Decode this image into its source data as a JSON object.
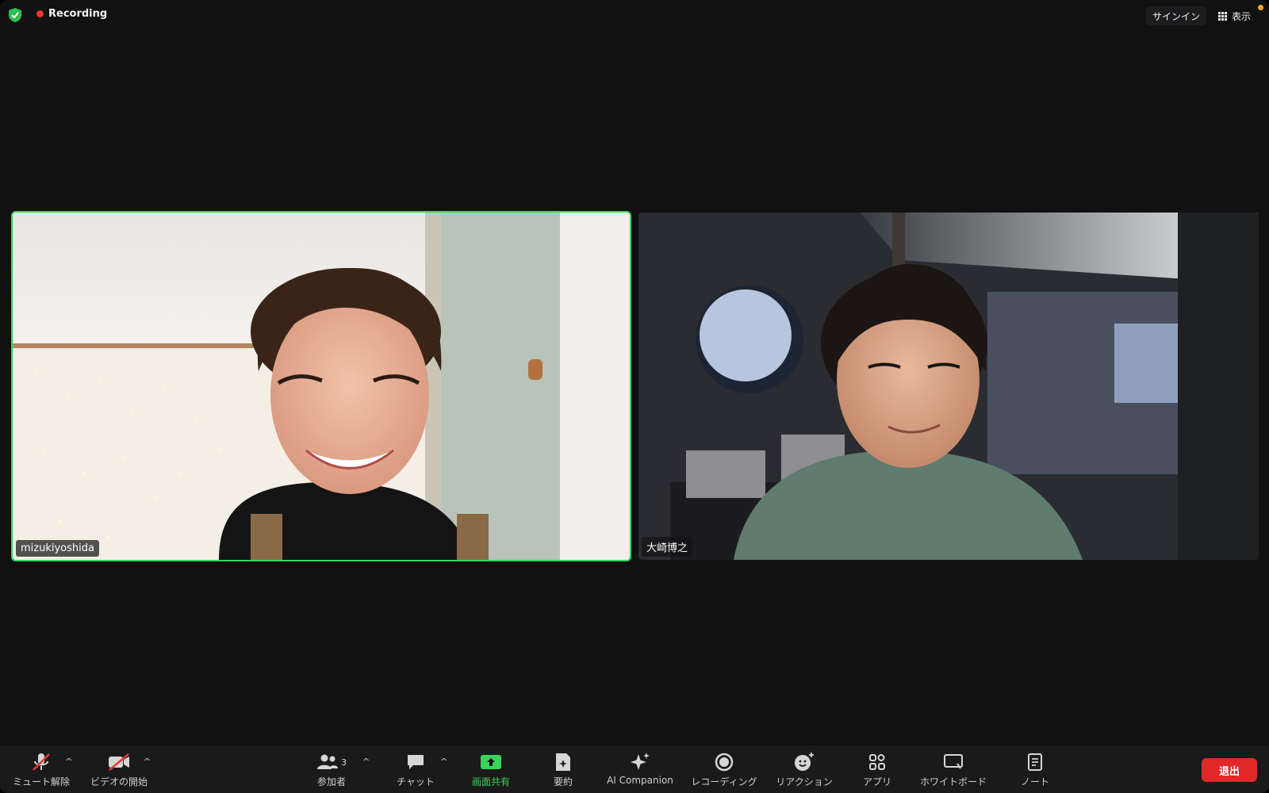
{
  "topbar": {
    "recording_label": "Recording",
    "signin_label": "サインイン",
    "view_label": "表示"
  },
  "participants": [
    {
      "name": "mizukiyoshida",
      "active_speaker": true
    },
    {
      "name": "大崎博之",
      "active_speaker": false
    }
  ],
  "toolbar": {
    "mute": "ミュート解除",
    "video": "ビデオの開始",
    "participants": "参加者",
    "participants_count": "3",
    "chat": "チャット",
    "share": "画面共有",
    "summary": "要約",
    "ai": "AI Companion",
    "record": "レコーディング",
    "reactions": "リアクション",
    "apps": "アプリ",
    "whiteboard": "ホワイトボード",
    "notes": "ノート",
    "leave": "退出"
  },
  "colors": {
    "active_border": "#3ad35b",
    "leave": "#e02828",
    "share": "#3ad35b",
    "recording_dot": "#e53935"
  }
}
